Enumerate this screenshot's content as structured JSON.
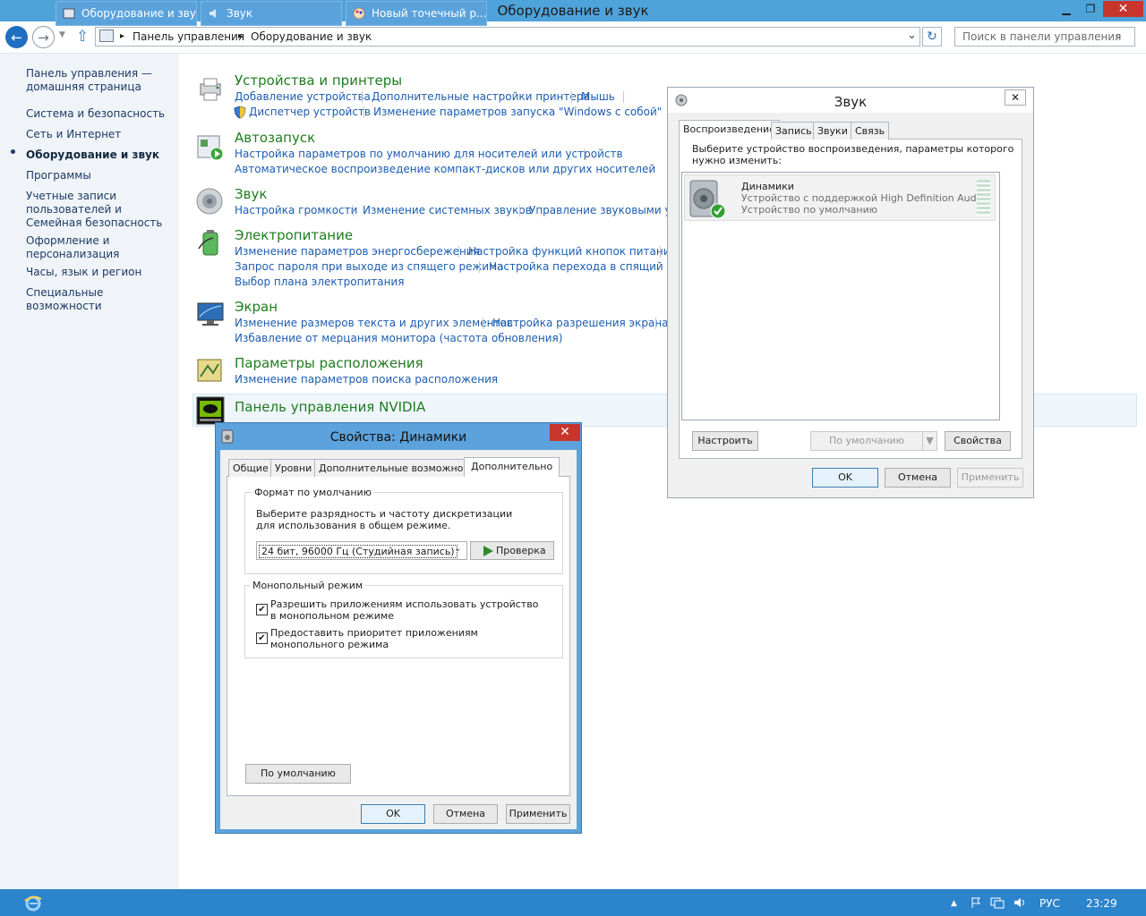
{
  "window": {
    "title": "Оборудование и звук",
    "min": "▁",
    "max": "❐",
    "close": "✕"
  },
  "nav": {
    "back": "←",
    "forward": "→",
    "history": "▼",
    "up": "⇧",
    "refresh": "↻",
    "search_icon": "⌕",
    "sep": "▸",
    "address_dd": "⌄"
  },
  "breadcrumb": [
    "Панель управления",
    "Оборудование и звук"
  ],
  "search": {
    "placeholder": "Поиск в панели управления"
  },
  "sidebar": {
    "items": [
      "Панель управления — домашняя страница",
      "Система и безопасность",
      "Сеть и Интернет",
      "Оборудование и звук",
      "Программы",
      "Учетные записи пользователей и Семейная безопасность",
      "Оформление и персонализация",
      "Часы, язык и регион",
      "Специальные возможности"
    ]
  },
  "categories": {
    "devices": {
      "title": "Устройства и принтеры",
      "links": [
        "Добавление устройства",
        "Дополнительные настройки принтера",
        "Мышь",
        "Диспетчер устройств",
        "Изменение параметров запуска \"Windows с собой\""
      ]
    },
    "autoplay": {
      "title": "Автозапуск",
      "links": [
        "Настройка параметров по умолчанию для носителей или устройств",
        "Автоматическое воспроизведение компакт-дисков или других носителей"
      ]
    },
    "sound": {
      "title": "Звук",
      "links": [
        "Настройка громкости",
        "Изменение системных звуков",
        "Управление звуковыми устр"
      ]
    },
    "power": {
      "title": "Электропитание",
      "links": [
        "Изменение параметров энергосбережения",
        "Настройка функций кнопок питания",
        "Запрос пароля при выходе из спящего режима",
        "Настройка перехода в спящий режи",
        "Выбор плана электропитания"
      ]
    },
    "display": {
      "title": "Экран",
      "links": [
        "Изменение размеров текста и других элементов",
        "Настройка разрешения экрана",
        "Избавление от мерцания монитора (частота обновления)"
      ]
    },
    "location": {
      "title": "Параметры расположения",
      "links": [
        "Изменение параметров поиска расположения"
      ]
    },
    "nvidia": {
      "title": "Панель управления NVIDIA"
    }
  },
  "sound_dialog": {
    "title": "Звук",
    "close": "✕",
    "tabs": [
      "Воспроизведение",
      "Запись",
      "Звуки",
      "Связь"
    ],
    "instruction": "Выберите устройство воспроизведения, параметры которого нужно изменить:",
    "device": {
      "name": "Динамики",
      "desc": "Устройство с поддержкой High Definition Audio",
      "status": "Устройство по умолчанию"
    },
    "buttons": {
      "configure": "Настроить",
      "set_default": "По умолчанию",
      "properties": "Свойства",
      "ok": "OK",
      "cancel": "Отмена",
      "apply": "Применить"
    }
  },
  "props_dialog": {
    "title": "Свойства: Динамики",
    "close": "✕",
    "tabs": [
      "Общие",
      "Уровни",
      "Дополнительные возможности",
      "Дополнительно"
    ],
    "format_group": "Формат по умолчанию",
    "format_hint": "Выберите разрядность и частоту дискретизации для использования в общем режиме.",
    "format_value": "24 бит, 96000 Гц (Студийная запись)",
    "test_button": "Проверка",
    "exclusive_group": "Монопольный режим",
    "check1": "Разрешить приложениям использовать устройство в монопольном режиме",
    "check2": "Предоставить приоритет приложениям монопольного режима",
    "check_mark": "✔",
    "default_button": "По умолчанию",
    "buttons": {
      "ok": "OK",
      "cancel": "Отмена",
      "apply": "Применить"
    }
  },
  "taskbar": {
    "items": [
      "Оборудование и звук",
      "Звук",
      "Новый точечный р..."
    ],
    "lang": "РУС",
    "time": "23:29",
    "tray_up": "▲"
  }
}
